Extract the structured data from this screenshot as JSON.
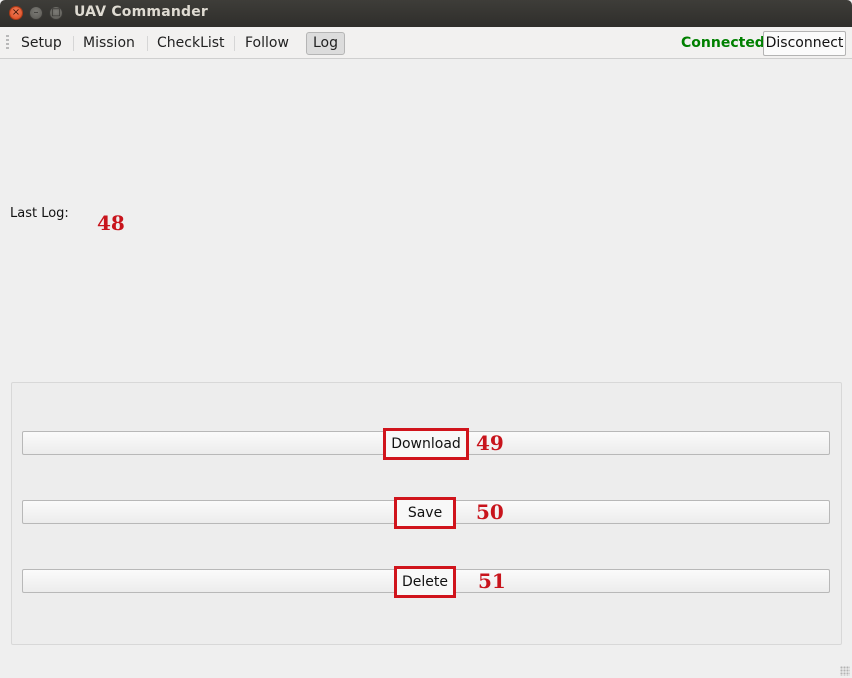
{
  "window": {
    "title": "UAV Commander",
    "close_glyph": "×",
    "min_glyph": "–",
    "max_glyph": "□"
  },
  "tabs": [
    {
      "label": "Setup"
    },
    {
      "label": "Mission"
    },
    {
      "label": "CheckList"
    },
    {
      "label": "Follow"
    },
    {
      "label": "Log",
      "active": true
    }
  ],
  "connection": {
    "status": "Connected",
    "status_color": "#008000",
    "button": "Disconnect"
  },
  "log": {
    "last_log_label": "Last Log:",
    "marker": "48"
  },
  "actions": [
    {
      "label": "Download",
      "marker": "49"
    },
    {
      "label": "Save",
      "marker": "50"
    },
    {
      "label": "Delete",
      "marker": "51"
    }
  ],
  "colors": {
    "annotation": "#c8141c",
    "title_bar": "#3a3935"
  }
}
